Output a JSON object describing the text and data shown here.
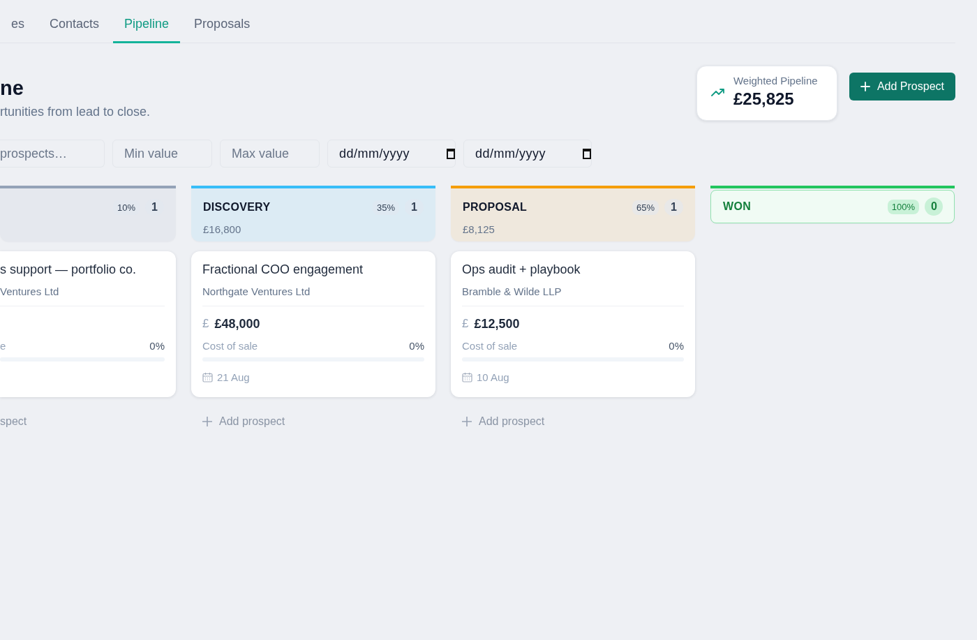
{
  "tabs": [
    {
      "label": "es",
      "selected": false
    },
    {
      "label": "Contacts",
      "selected": false
    },
    {
      "label": "Pipeline",
      "selected": true
    },
    {
      "label": "Proposals",
      "selected": false
    }
  ],
  "header": {
    "title": "ne",
    "subtitle": "rtunities from lead to close."
  },
  "weighted_pipeline": {
    "label": "Weighted Pipeline",
    "value": "£25,825"
  },
  "add_button": {
    "label": "Add Prospect"
  },
  "filters": [
    {
      "kind": "text",
      "placeholder": "prospects…"
    },
    {
      "kind": "text",
      "placeholder": "Min value"
    },
    {
      "kind": "text",
      "placeholder": "Max value"
    },
    {
      "kind": "date",
      "value": "dd/mm/yyyy"
    },
    {
      "kind": "date",
      "value": "dd/mm/yyyy"
    }
  ],
  "columns": [
    {
      "kind": "stage",
      "color": "#94a3b8",
      "percent": "10%",
      "count": "1",
      "cards": [
        {
          "title": "s support — portfolio co.",
          "company": "Ventures Ltd",
          "cost_label": "e",
          "cost_percent": "0%",
          "level": 0
        }
      ],
      "add_label": "spect"
    },
    {
      "kind": "stage",
      "color": "#38bdf8",
      "name": "DISCOVERY",
      "percent": "35%",
      "count": "1",
      "total": "£16,800",
      "cards": [
        {
          "title": "Fractional COO engagement",
          "company": "Northgate Ventures Ltd",
          "currency": "£",
          "value": "£48,000",
          "cost_label": "Cost of sale",
          "cost_percent": "0%",
          "level": 0,
          "date": "21 Aug"
        }
      ],
      "add_label": "Add prospect"
    },
    {
      "kind": "stage",
      "color": "#f59e0b",
      "name": "PROPOSAL",
      "percent": "65%",
      "count": "1",
      "total": "£8,125",
      "cards": [
        {
          "title": "Ops audit + playbook",
          "company": "Bramble & Wilde LLP",
          "currency": "£",
          "value": "£12,500",
          "cost_label": "Cost of sale",
          "cost_percent": "0%",
          "level": 0,
          "date": "10 Aug"
        }
      ],
      "add_label": "Add prospect"
    },
    {
      "kind": "won",
      "color": "#22c55e",
      "name": "WON",
      "percent": "100%",
      "count": "0"
    }
  ]
}
